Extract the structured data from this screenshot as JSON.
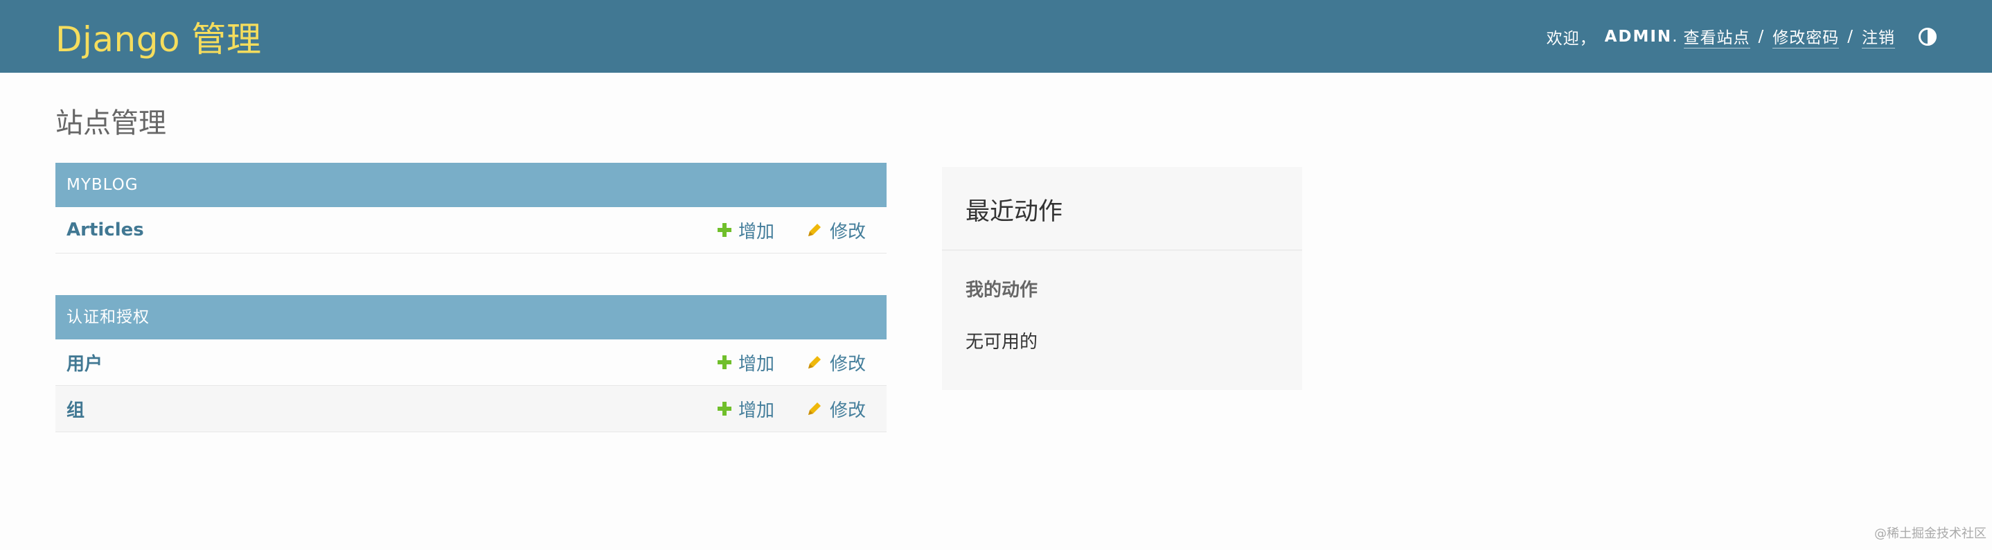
{
  "header": {
    "brand": "Django 管理",
    "welcome": "欢迎，",
    "username": "ADMIN",
    "view_site": "查看站点",
    "change_password": "修改密码",
    "logout": "注销",
    "separator": "/",
    "comma": "."
  },
  "page_title": "站点管理",
  "modules": [
    {
      "name": "MYBLOG",
      "models": [
        {
          "label": "Articles",
          "add": "增加",
          "change": "修改"
        }
      ]
    },
    {
      "name": "认证和授权",
      "models": [
        {
          "label": "用户",
          "add": "增加",
          "change": "修改"
        },
        {
          "label": "组",
          "add": "增加",
          "change": "修改"
        }
      ]
    }
  ],
  "recent_actions": {
    "title": "最近动作",
    "subtitle": "我的动作",
    "empty": "无可用的"
  },
  "watermark": "@稀土掘金技术社区",
  "colors": {
    "header_bg": "#417893",
    "brand": "#f5dd5d",
    "module_header": "#79aec8",
    "link": "#417893",
    "add_icon": "#70bf2b",
    "change_icon": "#efb80b"
  },
  "icons": {
    "add": "plus-icon",
    "change": "pencil-icon",
    "theme": "half-circle-icon"
  }
}
